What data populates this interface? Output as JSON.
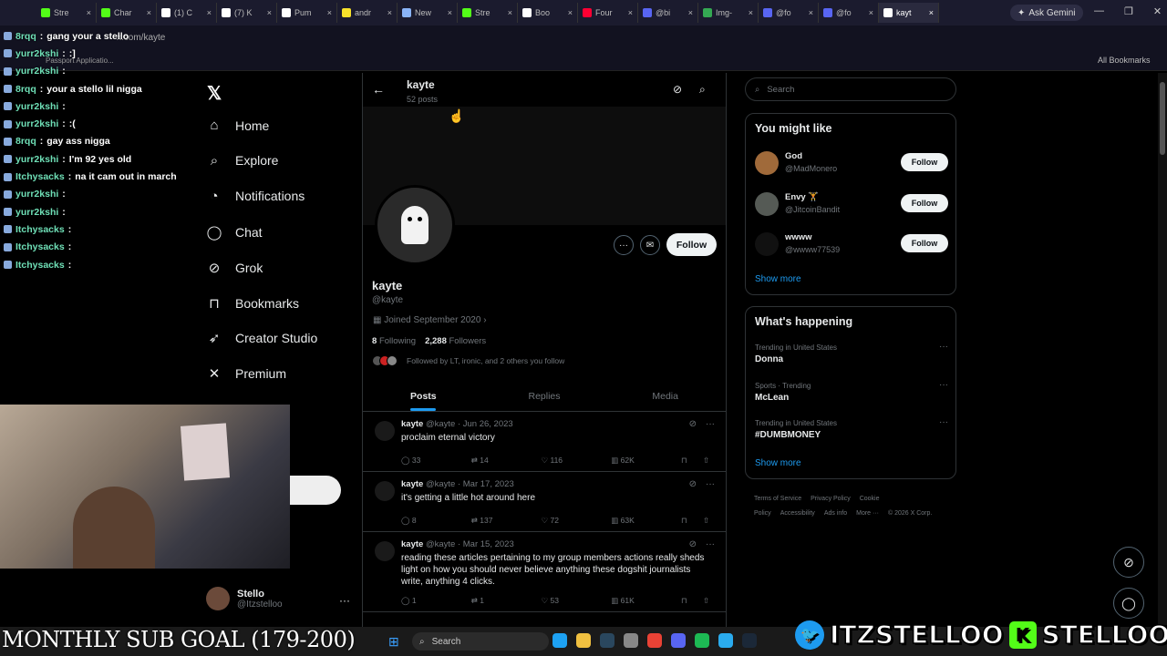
{
  "browser": {
    "tabs": [
      {
        "label": "Stre",
        "color": "#53fc18"
      },
      {
        "label": "Char",
        "color": "#53fc18"
      },
      {
        "label": "(1) C",
        "color": "#ffffff"
      },
      {
        "label": "(7) K",
        "color": "#ffffff"
      },
      {
        "label": "Pum",
        "color": "#ffffff"
      },
      {
        "label": "andr",
        "color": "#f7e12b"
      },
      {
        "label": "New",
        "color": "#8ab4f8"
      },
      {
        "label": "Stre",
        "color": "#53fc18"
      },
      {
        "label": "Boo",
        "color": "#ffffff"
      },
      {
        "label": "Four",
        "color": "#ff0033"
      },
      {
        "label": "@bi",
        "color": "#5865f2"
      },
      {
        "label": "Img-",
        "color": "#34a853"
      },
      {
        "label": "@fo",
        "color": "#5865f2"
      },
      {
        "label": "@fo",
        "color": "#5865f2"
      },
      {
        "label": "kayt",
        "color": "#ffffff",
        "active": true
      }
    ],
    "gemini_label": "Ask Gemini",
    "url": "x.com/kayte",
    "bookmark_left": "Passport Applicatio...",
    "bookmark_right": "All Bookmarks"
  },
  "chat": [
    {
      "user": "8rqq",
      "msg": "gang your a stello"
    },
    {
      "user": "yurr2kshi",
      "msg": ":]"
    },
    {
      "user": "yurr2kshi",
      "msg": ""
    },
    {
      "user": "8rqq",
      "msg": "your a stello lil nigga"
    },
    {
      "user": "yurr2kshi",
      "msg": ""
    },
    {
      "user": "yurr2kshi",
      "msg": ":("
    },
    {
      "user": "8rqq",
      "msg": "gay ass nigga"
    },
    {
      "user": "yurr2kshi",
      "msg": "I'm 92 yes old"
    },
    {
      "user": "Itchysacks",
      "msg": "na it cam out in march"
    },
    {
      "user": "yurr2kshi",
      "msg": ""
    },
    {
      "user": "yurr2kshi",
      "msg": ""
    },
    {
      "user": "Itchysacks",
      "msg": ""
    },
    {
      "user": "Itchysacks",
      "msg": ""
    },
    {
      "user": "Itchysacks",
      "msg": ""
    }
  ],
  "nav": [
    {
      "label": "Home",
      "icon": "home-icon",
      "glyph": "⌂"
    },
    {
      "label": "Explore",
      "icon": "search-icon",
      "glyph": "⌕"
    },
    {
      "label": "Notifications",
      "icon": "bell-icon",
      "glyph": "◔"
    },
    {
      "label": "Chat",
      "icon": "chat-icon",
      "glyph": "◯"
    },
    {
      "label": "Grok",
      "icon": "grok-icon",
      "glyph": "⊘"
    },
    {
      "label": "Bookmarks",
      "icon": "bookmark-icon",
      "glyph": "⊓"
    },
    {
      "label": "Creator Studio",
      "icon": "rocket-icon",
      "glyph": "➶"
    },
    {
      "label": "Premium",
      "icon": "x-logo-icon",
      "glyph": "✕"
    }
  ],
  "logo": "𝕏",
  "account": {
    "name": "Stello",
    "handle": "@Itzstelloo"
  },
  "profile_header": {
    "name": "kayte",
    "posts": "52 posts"
  },
  "profile": {
    "name": "kayte",
    "handle": "@kayte",
    "joined": "Joined September 2020",
    "following_count": "8",
    "following_label": "Following",
    "followers_count": "2,288",
    "followers_label": "Followers",
    "followed_by": "Followed by LT, ironic, and 2 others you follow",
    "follow_label": "Follow"
  },
  "tabs": [
    "Posts",
    "Replies",
    "Media"
  ],
  "posts": [
    {
      "name": "kayte",
      "meta": "@kayte · Jun 26, 2023",
      "text": "proclaim eternal victory",
      "replies": "33",
      "reposts": "14",
      "likes": "116",
      "views": "62K"
    },
    {
      "name": "kayte",
      "meta": "@kayte · Mar 17, 2023",
      "text": "it's getting a little hot around here",
      "replies": "8",
      "reposts": "137",
      "likes": "72",
      "views": "63K"
    },
    {
      "name": "kayte",
      "meta": "@kayte · Mar 15, 2023",
      "text": "reading these articles pertaining to my group members actions really sheds light on how you should never believe anything these dogshit journalists write, anything 4 clicks.",
      "replies": "1",
      "reposts": "1",
      "likes": "53",
      "views": "61K"
    }
  ],
  "search_placeholder": "Search",
  "you_might_like": {
    "title": "You might like",
    "items": [
      {
        "name": "God",
        "handle": "@MadMonero",
        "color": "#a06a3a"
      },
      {
        "name": "Envy 🏋",
        "handle": "@JitcoinBandit",
        "color": "#555a55"
      },
      {
        "name": "wwww",
        "handle": "@wwww77539",
        "color": "#111111"
      }
    ],
    "follow_label": "Follow",
    "show_more": "Show more"
  },
  "whats_happening": {
    "title": "What's happening",
    "trends": [
      {
        "context": "Trending in United States",
        "name": "Donna"
      },
      {
        "context": "Sports · Trending",
        "name": "McLean"
      },
      {
        "context": "Trending in United States",
        "name": "#DUMBMONEY"
      }
    ],
    "show_more": "Show more"
  },
  "footer": [
    "Terms of Service",
    "Privacy Policy",
    "Cookie Policy",
    "Accessibility",
    "Ads info",
    "More ···",
    "© 2026 X Corp."
  ],
  "overlay": {
    "sub_goal": "MONTHLY SUB GOAL (179-200)",
    "twitter_handle": "ITZSTELLOO",
    "kick_handle": "STELLOOO"
  },
  "taskbar": {
    "search": "Search"
  },
  "colors": {
    "accent": "#1d9bf0",
    "kick": "#53fc18",
    "chat_user": "#6fe0b7"
  }
}
